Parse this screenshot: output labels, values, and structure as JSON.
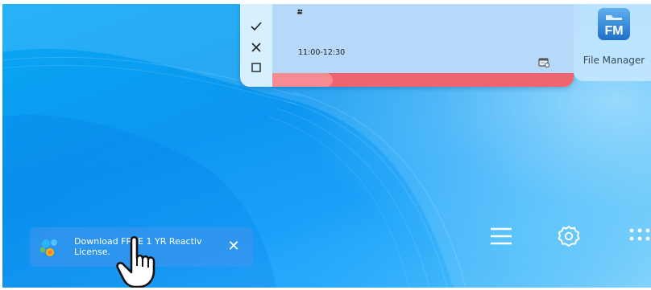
{
  "task_card": {
    "time_range": "11:00-12:30",
    "progress_fraction": 0.2,
    "actions": [
      "check-icon",
      "close-icon",
      "square-icon"
    ]
  },
  "file_manager": {
    "icon_text": "FM",
    "label": "File Manager"
  },
  "notification": {
    "text": "Download FREE 1 YR Reactiv License.",
    "close_glyph": "✕"
  },
  "dock": {
    "items": [
      "menu-icon",
      "settings-icon",
      "apps-grid-icon"
    ]
  },
  "colors": {
    "wallpaper": "#0b95ef",
    "task_card": "#b7d9f9",
    "progress_track": "#ee6570",
    "progress_fill": "#f68b93",
    "notification": "#4696eb"
  }
}
